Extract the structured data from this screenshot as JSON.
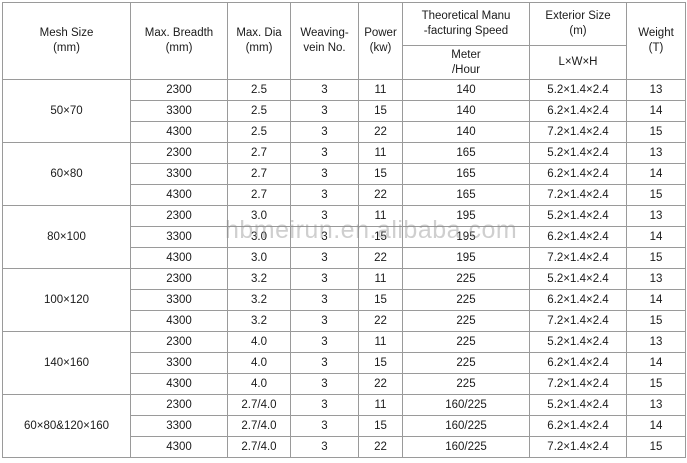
{
  "headers": {
    "mesh_size": [
      "Mesh Size",
      "(mm)"
    ],
    "max_breadth": [
      "Max. Breadth",
      "(mm)"
    ],
    "max_dia": [
      "Max. Dia",
      "(mm)"
    ],
    "weaving_vein": [
      "Weaving-",
      "vein No."
    ],
    "power": [
      "Power",
      "(kw)"
    ],
    "theoretical": [
      "Theoretical Manu",
      "-facturing Speed"
    ],
    "meter_hour": [
      "Meter",
      "/Hour"
    ],
    "exterior": [
      "Exterior Size",
      "(m)"
    ],
    "lwh": "L×W×H",
    "weight": [
      "Weight",
      "(T)"
    ]
  },
  "groups": [
    {
      "mesh": "50×70",
      "rows": [
        {
          "breadth": "2300",
          "dia": "2.5",
          "vein": "3",
          "power": "11",
          "speed": "140",
          "size": "5.2×1.4×2.4",
          "weight": "13"
        },
        {
          "breadth": "3300",
          "dia": "2.5",
          "vein": "3",
          "power": "15",
          "speed": "140",
          "size": "6.2×1.4×2.4",
          "weight": "14"
        },
        {
          "breadth": "4300",
          "dia": "2.5",
          "vein": "3",
          "power": "22",
          "speed": "140",
          "size": "7.2×1.4×2.4",
          "weight": "15"
        }
      ]
    },
    {
      "mesh": "60×80",
      "rows": [
        {
          "breadth": "2300",
          "dia": "2.7",
          "vein": "3",
          "power": "11",
          "speed": "165",
          "size": "5.2×1.4×2.4",
          "weight": "13"
        },
        {
          "breadth": "3300",
          "dia": "2.7",
          "vein": "3",
          "power": "15",
          "speed": "165",
          "size": "6.2×1.4×2.4",
          "weight": "14"
        },
        {
          "breadth": "4300",
          "dia": "2.7",
          "vein": "3",
          "power": "22",
          "speed": "165",
          "size": "7.2×1.4×2.4",
          "weight": "15"
        }
      ]
    },
    {
      "mesh": "80×100",
      "rows": [
        {
          "breadth": "2300",
          "dia": "3.0",
          "vein": "3",
          "power": "11",
          "speed": "195",
          "size": "5.2×1.4×2.4",
          "weight": "13"
        },
        {
          "breadth": "3300",
          "dia": "3.0",
          "vein": "3",
          "power": "15",
          "speed": "195",
          "size": "6.2×1.4×2.4",
          "weight": "14"
        },
        {
          "breadth": "4300",
          "dia": "3.0",
          "vein": "3",
          "power": "22",
          "speed": "195",
          "size": "7.2×1.4×2.4",
          "weight": "15"
        }
      ]
    },
    {
      "mesh": "100×120",
      "rows": [
        {
          "breadth": "2300",
          "dia": "3.2",
          "vein": "3",
          "power": "11",
          "speed": "225",
          "size": "5.2×1.4×2.4",
          "weight": "13"
        },
        {
          "breadth": "3300",
          "dia": "3.2",
          "vein": "3",
          "power": "15",
          "speed": "225",
          "size": "6.2×1.4×2.4",
          "weight": "14"
        },
        {
          "breadth": "4300",
          "dia": "3.2",
          "vein": "3",
          "power": "22",
          "speed": "225",
          "size": "7.2×1.4×2.4",
          "weight": "15"
        }
      ]
    },
    {
      "mesh": "140×160",
      "rows": [
        {
          "breadth": "2300",
          "dia": "4.0",
          "vein": "3",
          "power": "11",
          "speed": "225",
          "size": "5.2×1.4×2.4",
          "weight": "13"
        },
        {
          "breadth": "3300",
          "dia": "4.0",
          "vein": "3",
          "power": "15",
          "speed": "225",
          "size": "6.2×1.4×2.4",
          "weight": "14"
        },
        {
          "breadth": "4300",
          "dia": "4.0",
          "vein": "3",
          "power": "22",
          "speed": "225",
          "size": "7.2×1.4×2.4",
          "weight": "15"
        }
      ]
    },
    {
      "mesh": "60×80&120×160",
      "rows": [
        {
          "breadth": "2300",
          "dia": "2.7/4.0",
          "vein": "3",
          "power": "11",
          "speed": "160/225",
          "size": "5.2×1.4×2.4",
          "weight": "13"
        },
        {
          "breadth": "3300",
          "dia": "2.7/4.0",
          "vein": "3",
          "power": "15",
          "speed": "160/225",
          "size": "6.2×1.4×2.4",
          "weight": "14"
        },
        {
          "breadth": "4300",
          "dia": "2.7/4.0",
          "vein": "3",
          "power": "22",
          "speed": "160/225",
          "size": "7.2×1.4×2.4",
          "weight": "15"
        }
      ]
    }
  ],
  "watermark": "hbmeirun.en.alibaba.com"
}
